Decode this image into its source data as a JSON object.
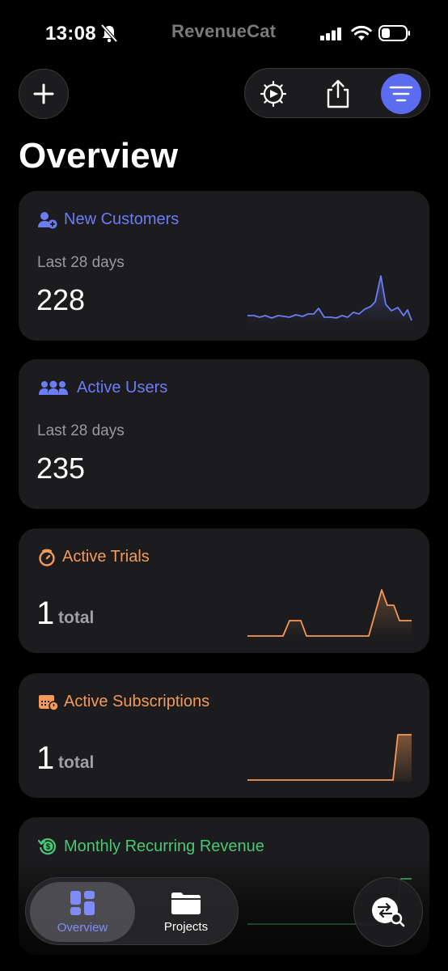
{
  "status_bar": {
    "time": "13:08",
    "app_brand": "RevenueCat"
  },
  "page": {
    "title": "Overview"
  },
  "cards": {
    "new_customers": {
      "title": "New Customers",
      "period": "Last 28 days",
      "value": "228",
      "accent": "#6b7cf5",
      "icon": "add-person-icon"
    },
    "active_users": {
      "title": "Active Users",
      "period": "Last 28 days",
      "value": "235",
      "accent": "#6b7cf5",
      "icon": "people-icon"
    },
    "active_trials": {
      "title": "Active Trials",
      "value": "1",
      "unit": "total",
      "accent": "#f39a5a",
      "icon": "timer-icon"
    },
    "active_subscriptions": {
      "title": "Active Subscriptions",
      "value": "1",
      "unit": "total",
      "accent": "#f39a5a",
      "icon": "calendar-badge-icon"
    },
    "mrr": {
      "title": "Monthly Recurring Revenue",
      "accent": "#48c774",
      "icon": "dollar-refresh-icon"
    }
  },
  "tab_bar": {
    "overview_label": "Overview",
    "projects_label": "Projects"
  },
  "colors": {
    "accent_primary": "#5b6cf0",
    "card_bg": "#1c1c1e"
  }
}
